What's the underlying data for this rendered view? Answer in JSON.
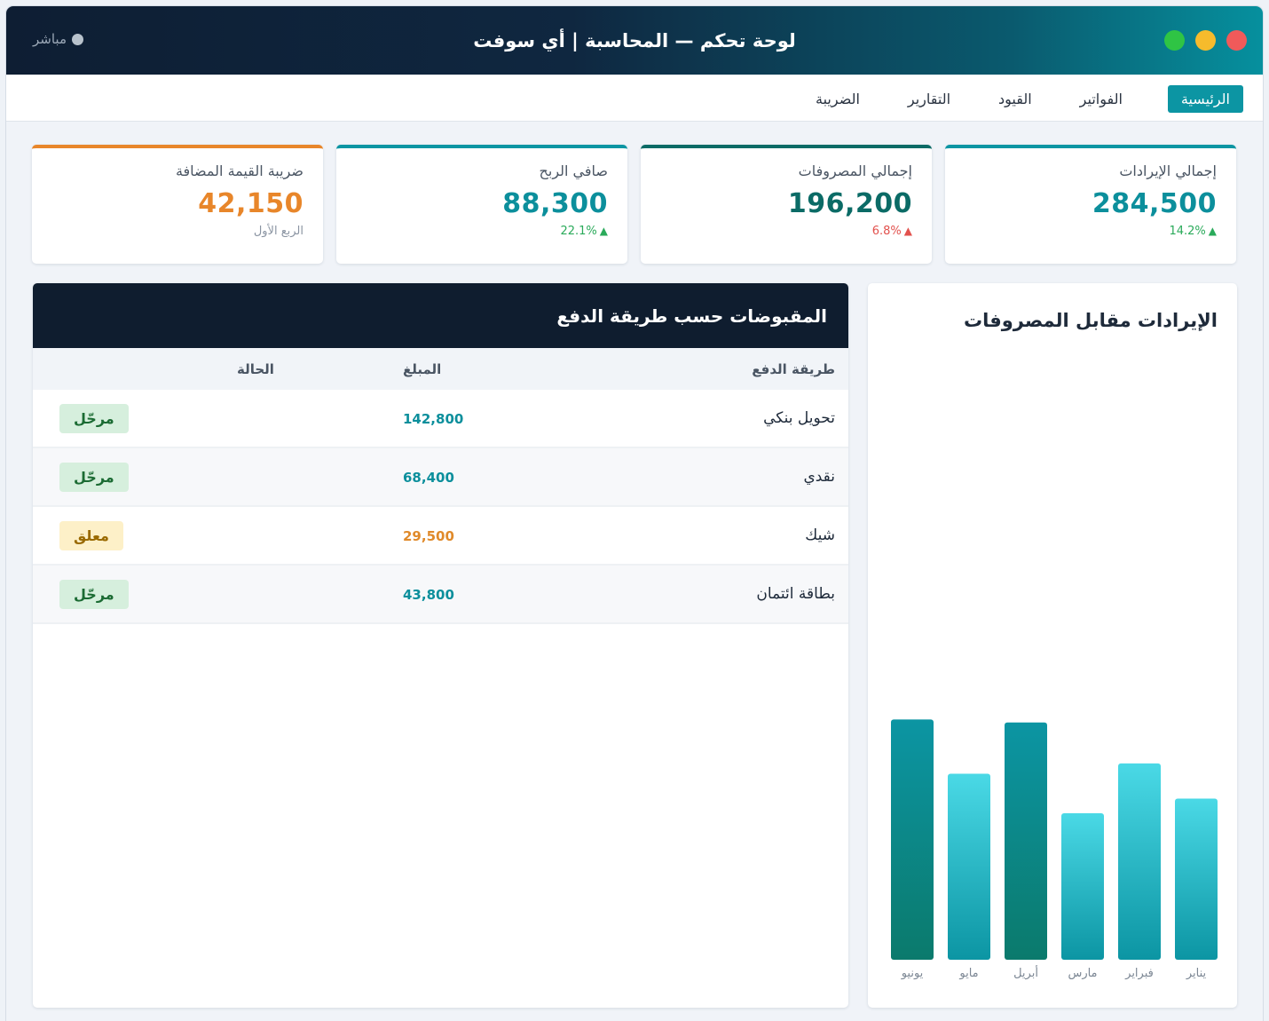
{
  "window": {
    "title": "لوحة تحكم — المحاسبة | أي سوفت",
    "status_label": "مباشر"
  },
  "nav": {
    "tabs": [
      {
        "label": "الرئيسية",
        "active": true
      },
      {
        "label": "الفواتير",
        "active": false
      },
      {
        "label": "القيود",
        "active": false
      },
      {
        "label": "التقارير",
        "active": false
      },
      {
        "label": "الضريبة",
        "active": false
      }
    ]
  },
  "kpis": [
    {
      "label": "إجمالي الإيرادات",
      "value": "284,500",
      "change": "14.2%",
      "direction": "up",
      "color": "#0c95a3",
      "value_color": "#0c8f9c"
    },
    {
      "label": "إجمالي المصروفات",
      "value": "196,200",
      "change": "6.8%",
      "direction": "down",
      "color": "#0b6b66",
      "value_color": "#0b6b66"
    },
    {
      "label": "صافي الربح",
      "value": "88,300",
      "change": "22.1%",
      "direction": "up",
      "color": "#0c95a3",
      "value_color": "#0c8f9c"
    },
    {
      "label": "ضريبة القيمة المضافة",
      "value": "42,150",
      "note": "الربع الأول",
      "color": "#e8862a",
      "value_color": "#e8862a"
    }
  ],
  "chart": {
    "title": "الإيرادات مقابل المصروفات"
  },
  "chart_data": {
    "type": "bar",
    "categories": [
      "يناير",
      "فبراير",
      "مارس",
      "أبريل",
      "مايو",
      "يونيو"
    ],
    "values": [
      110,
      134,
      100,
      162,
      127,
      164
    ],
    "highlight": [
      false,
      false,
      false,
      true,
      false,
      true
    ],
    "colors": {
      "normal_top": "#4ad9e6",
      "normal_bottom": "#0c95a3",
      "highlight_top": "#0c95a3",
      "highlight_bottom": "#0b7a6c"
    },
    "ylim": [
      0,
      200
    ],
    "grid": false,
    "title": "الإيرادات مقابل المصروفات"
  },
  "receipts": {
    "title": "المقبوضات حسب طريقة الدفع",
    "columns": [
      "طريقة الدفع",
      "المبلغ",
      "الحالة"
    ],
    "rows": [
      {
        "method": "تحويل بنكي",
        "amount": "142,800",
        "amount_color": "#0c8f9c",
        "status": "مرحّل",
        "status_type": "ok"
      },
      {
        "method": "نقدي",
        "amount": "68,400",
        "amount_color": "#0c8f9c",
        "status": "مرحّل",
        "status_type": "ok"
      },
      {
        "method": "شيك",
        "amount": "29,500",
        "amount_color": "#e08a2a",
        "status": "معلق",
        "status_type": "pending"
      },
      {
        "method": "بطاقة ائتمان",
        "amount": "43,800",
        "amount_color": "#0c8f9c",
        "status": "مرحّل",
        "status_type": "ok"
      }
    ]
  }
}
